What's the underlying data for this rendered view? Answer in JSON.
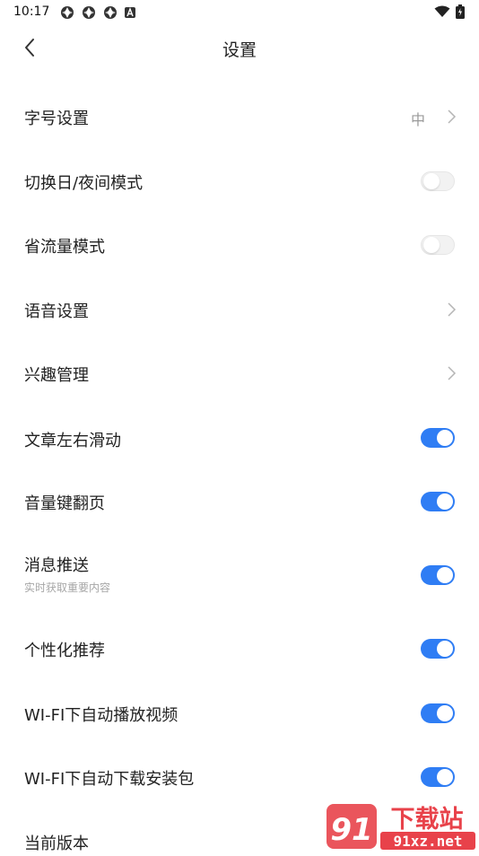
{
  "status_bar": {
    "time": "10:17",
    "notification_icons": [
      "app-icon",
      "app-icon",
      "app-icon",
      "a-badge-icon"
    ],
    "right_icons": [
      "wifi-icon",
      "battery-charging-icon"
    ]
  },
  "header": {
    "title": "设置",
    "back_icon": "back-arrow-icon"
  },
  "settings": [
    {
      "label": "字号设置",
      "value": "中",
      "control": "chevron"
    },
    {
      "label": "切换日/夜间模式",
      "control": "toggle",
      "on": false
    },
    {
      "label": "省流量模式",
      "control": "toggle",
      "on": false
    },
    {
      "label": "语音设置",
      "control": "chevron"
    },
    {
      "label": "兴趣管理",
      "control": "chevron"
    },
    {
      "label": "文章左右滑动",
      "control": "toggle",
      "on": true
    },
    {
      "label": "音量键翻页",
      "control": "toggle",
      "on": true
    },
    {
      "label": "消息推送",
      "sub": "实时获取重要内容",
      "control": "toggle",
      "on": true
    },
    {
      "label": "个性化推荐",
      "control": "toggle",
      "on": true
    },
    {
      "label": "WI-FI下自动播放视频",
      "control": "toggle",
      "on": true
    },
    {
      "label": "WI-FI下自动下载安装包",
      "control": "toggle",
      "on": true
    },
    {
      "label": "当前版本"
    }
  ],
  "watermark": {
    "line1": "下载站",
    "line2": "91xz.net"
  },
  "colors": {
    "accent": "#2f7df4",
    "toggle_off": "#f2f2f2",
    "watermark": "#e8424a"
  }
}
